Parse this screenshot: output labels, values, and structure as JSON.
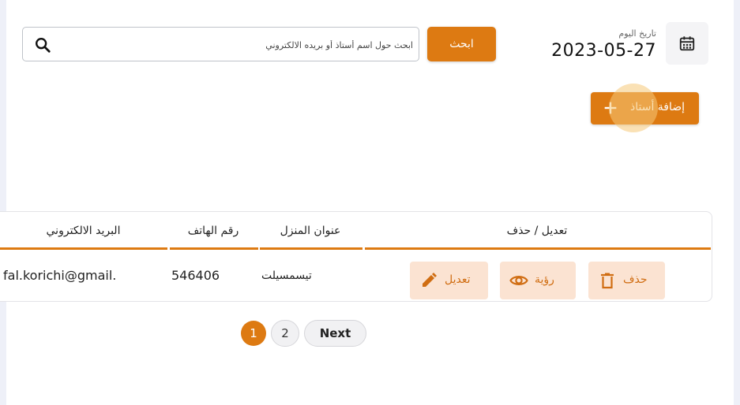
{
  "header": {
    "date_label": "تاريخ اليوم",
    "date_value": "2023-05-27",
    "search_button": "ابحث",
    "search_placeholder": "ابحث حول اسم أستاذ أو بريده الالكتروني",
    "add_teacher_button": "إضافة أستاذ"
  },
  "table": {
    "columns": [
      "تعديل / حذف",
      "عنوان المنزل",
      "رقم الهاتف",
      "البريد الالكتروني"
    ],
    "rows": [
      {
        "email": "fal.korichi@gmail.",
        "phone": "546406",
        "address": "تيسمسيلت",
        "actions": {
          "delete": "حذف",
          "view": "رؤية",
          "edit": "تعديل"
        }
      }
    ]
  },
  "pagination": {
    "pages": [
      "1",
      "2"
    ],
    "current": "1",
    "next": "Next"
  },
  "icons": {
    "calendar": "calendar-icon",
    "search": "search-icon",
    "plus": "plus-icon",
    "trash": "trash-icon",
    "eye": "eye-icon",
    "pencil": "pencil-icon"
  },
  "colors": {
    "accent": "#dd7a12",
    "action_bg": "#fbe3d2"
  }
}
